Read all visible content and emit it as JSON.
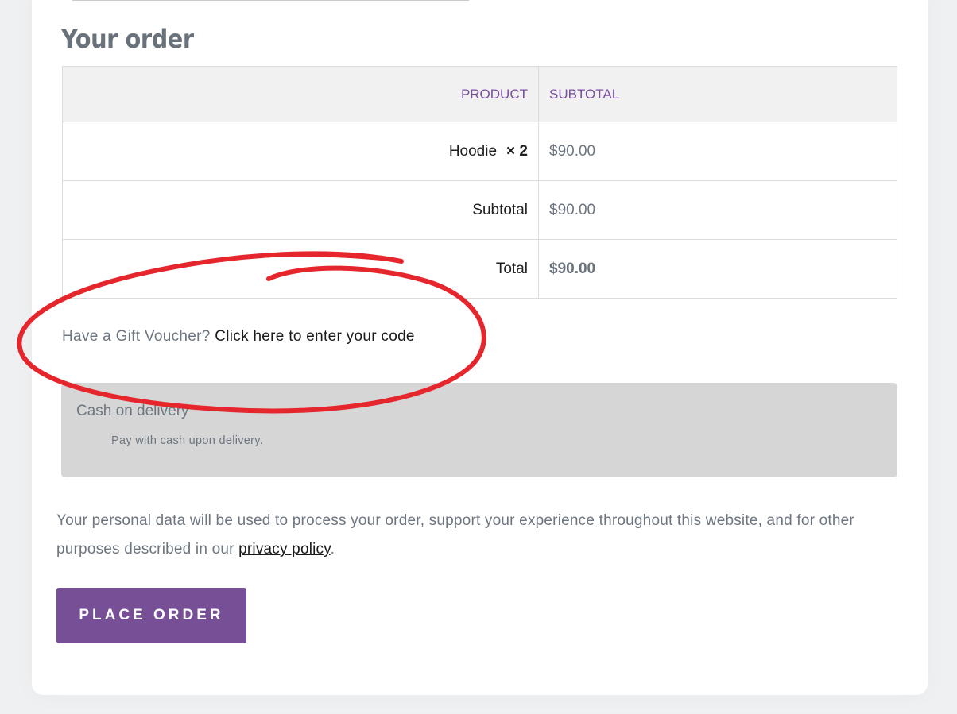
{
  "checkout": {
    "heading": "Your order",
    "table": {
      "headers": {
        "product": "PRODUCT",
        "subtotal": "SUBTOTAL"
      },
      "items": [
        {
          "name": "Hoodie",
          "qty": "× 2",
          "price": "$90.00"
        }
      ],
      "subtotal_label": "Subtotal",
      "subtotal_value": "$90.00",
      "total_label": "Total",
      "total_value": "$90.00"
    },
    "voucher": {
      "prompt": "Have a Gift Voucher?",
      "link": "Click here to enter your code"
    },
    "payment": {
      "method": "Cash on delivery",
      "description": "Pay with cash upon delivery."
    },
    "privacy": {
      "text": "Your personal data will be used to process your order, support your experience throughout this website, and for other purposes described in our",
      "link": "privacy policy",
      "end": "."
    },
    "place_order": "PLACE ORDER"
  },
  "colors": {
    "accent": "#764f97",
    "header_text": "#7a4fa0",
    "annotation": "#e5262d",
    "payment_bg": "#d6d6d6"
  },
  "annotation": {
    "shape": "red hand-drawn ellipse circling the gift voucher link"
  }
}
